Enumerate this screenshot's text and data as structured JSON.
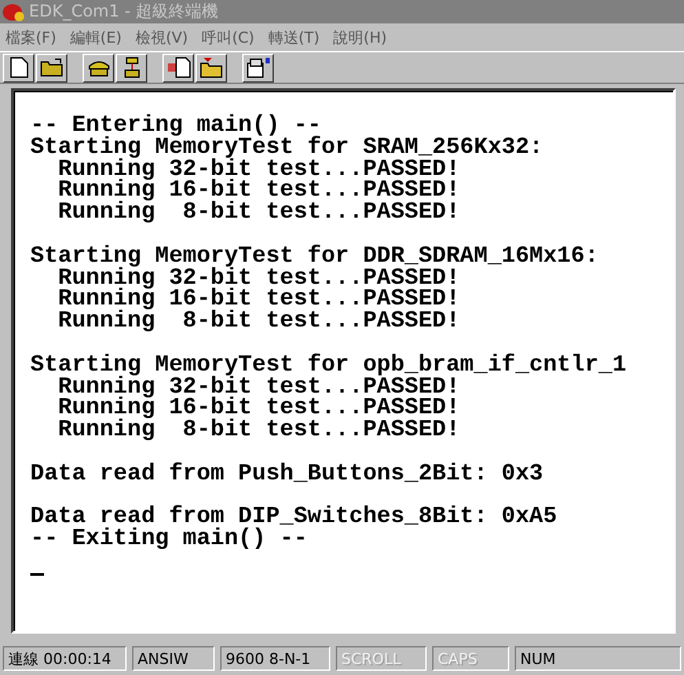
{
  "window": {
    "title": "EDK_Com1 - 超級終端機"
  },
  "menu": [
    {
      "label": "檔案(F)"
    },
    {
      "label": "編輯(E)"
    },
    {
      "label": "檢視(V)"
    },
    {
      "label": "呼叫(C)"
    },
    {
      "label": "轉送(T)"
    },
    {
      "label": "說明(H)"
    }
  ],
  "toolbar": [
    {
      "kind": "new"
    },
    {
      "kind": "open"
    },
    {
      "kind": "call"
    },
    {
      "kind": "hangup"
    },
    {
      "kind": "send"
    },
    {
      "kind": "receive"
    },
    {
      "kind": "properties"
    }
  ],
  "terminal": {
    "blocks": [
      [
        "-- Entering main() --",
        "Starting MemoryTest for SRAM_256Kx32:",
        "  Running 32-bit test...PASSED!",
        "  Running 16-bit test...PASSED!",
        "  Running  8-bit test...PASSED!"
      ],
      [
        "Starting MemoryTest for DDR_SDRAM_16Mx16:",
        "  Running 32-bit test...PASSED!",
        "  Running 16-bit test...PASSED!",
        "  Running  8-bit test...PASSED!"
      ],
      [
        "Starting MemoryTest for opb_bram_if_cntlr_1",
        "  Running 32-bit test...PASSED!",
        "  Running 16-bit test...PASSED!",
        "  Running  8-bit test...PASSED!"
      ],
      [
        "Data read from Push_Buttons_2Bit: 0x3"
      ],
      [
        "Data read from DIP_Switches_8Bit: 0xA5",
        "-- Exiting main() --"
      ]
    ]
  },
  "status_bar": [
    {
      "text": "連線 00:00:14",
      "disabled": false
    },
    {
      "text": "ANSIW",
      "disabled": false
    },
    {
      "text": "9600 8-N-1",
      "disabled": false
    },
    {
      "text": "SCROLL",
      "disabled": true
    },
    {
      "text": "CAPS",
      "disabled": true
    },
    {
      "text": "NUM",
      "disabled": false
    }
  ]
}
